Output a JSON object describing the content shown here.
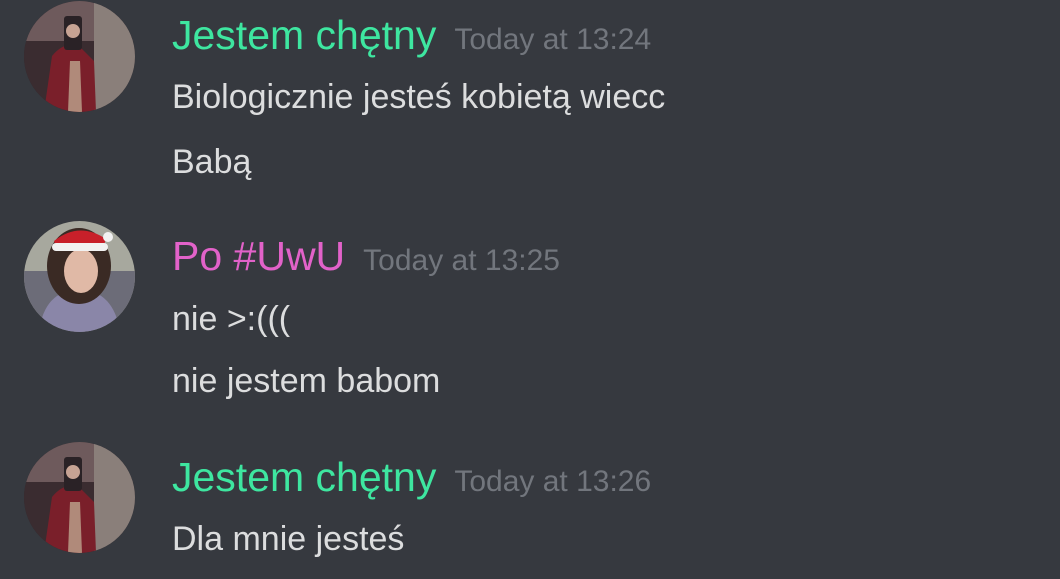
{
  "colors": {
    "background": "#36393f",
    "user_green": "#3ee6a0",
    "user_pink": "#e262c9",
    "timestamp": "#72767d",
    "message_text": "#dcddde"
  },
  "messages": [
    {
      "author": "Jestem chętny",
      "timestamp": "Today at 13:24",
      "lines": [
        "Biologicznie jesteś kobietą wiecc",
        "Babą"
      ]
    },
    {
      "author": "Po #UwU",
      "timestamp": "Today at 13:25",
      "lines": [
        "nie >:(((",
        "nie jestem babom"
      ]
    },
    {
      "author": "Jestem chętny",
      "timestamp": "Today at 13:26",
      "lines": [
        "Dla mnie jesteś"
      ]
    }
  ]
}
